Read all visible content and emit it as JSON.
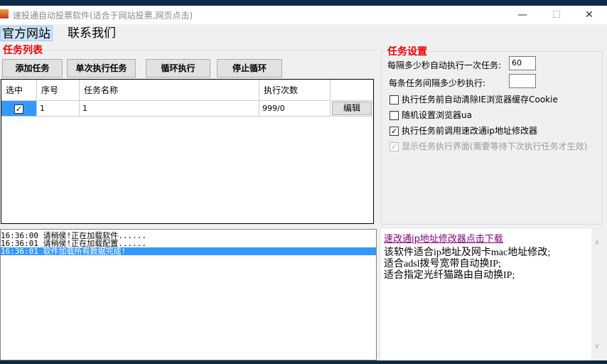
{
  "window": {
    "title": "速投通自动投票软件(适合于网站投票,网页点击)",
    "minimize": "—",
    "maximize": "☐",
    "close": "✕"
  },
  "menu": [
    {
      "label": "官方网站"
    },
    {
      "label": "联系我们"
    }
  ],
  "task_list": {
    "group_label": "任务列表",
    "buttons": [
      "添加任务",
      "单次执行任务",
      "循环执行",
      "停止循环"
    ],
    "columns": [
      "选中",
      "序号",
      "任务名称",
      "执行次数",
      ""
    ],
    "rows": [
      {
        "checked": true,
        "index": "1",
        "name": "1",
        "count": "999/0",
        "action": "编辑"
      }
    ]
  },
  "settings": {
    "group_label": "任务设置",
    "interval_label": "每隔多少秒自动执行一次任务:",
    "interval_value": "60",
    "task_gap_label": "每条任务间隔多少秒执行:",
    "task_gap_value": "",
    "options": [
      {
        "label": "执行任务前自动清除IE浏览器缓存Cookie",
        "checked": false,
        "enabled": true
      },
      {
        "label": "随机设置浏览器ua",
        "checked": false,
        "enabled": true
      },
      {
        "label": "执行任务前调用速改通ip地址修改器",
        "checked": true,
        "enabled": true
      },
      {
        "label": "显示任务执行界面(需要等待下次执行任务才生效)",
        "checked": true,
        "enabled": false
      }
    ]
  },
  "log": [
    {
      "time": "16:36:00",
      "text": "请稍侯!正在加载软件......"
    },
    {
      "time": "16:36:01",
      "text": "请稍侯!正在加载配置......"
    },
    {
      "time": "16:36:01",
      "text": "软件加载所有数据完成!",
      "selected": true
    }
  ],
  "info": {
    "link": "速改通ip地址修改器点击下载",
    "lines": [
      "该软件适合ip地址及网卡mac地址修改;",
      "适合adsl拨号宽带自动换IP;",
      "适合指定光纤猫路由自动换IP;"
    ]
  }
}
